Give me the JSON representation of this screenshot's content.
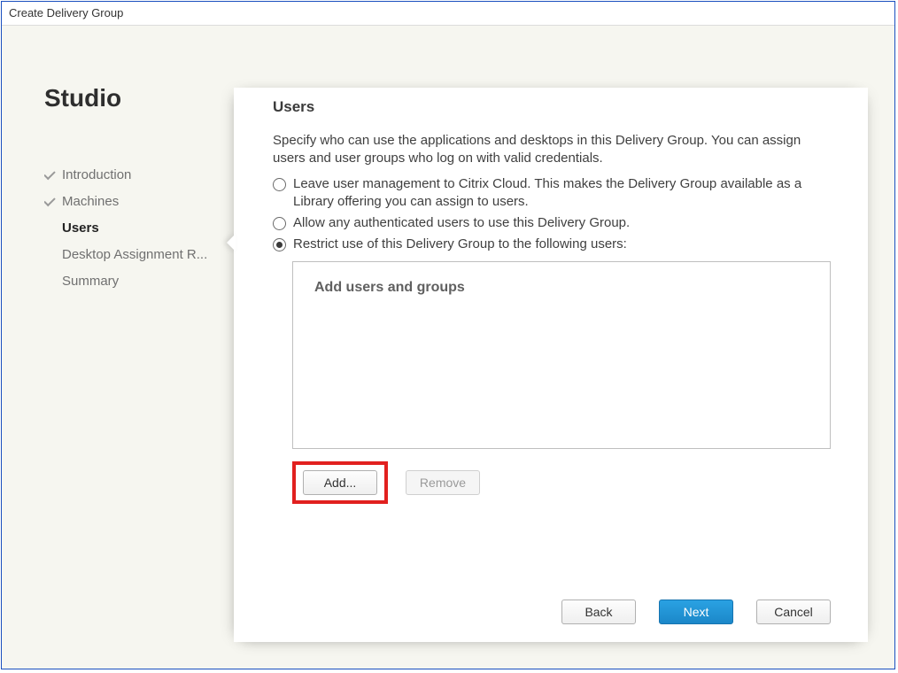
{
  "window": {
    "title": "Create Delivery Group"
  },
  "sidebar": {
    "title": "Studio",
    "items": [
      {
        "label": "Introduction",
        "state": "completed"
      },
      {
        "label": "Machines",
        "state": "completed"
      },
      {
        "label": "Users",
        "state": "current"
      },
      {
        "label": "Desktop Assignment R...",
        "state": "pending"
      },
      {
        "label": "Summary",
        "state": "pending"
      }
    ]
  },
  "page": {
    "title": "Users",
    "description": "Specify who can use the applications and desktops in this Delivery Group. You can assign users and user groups who log on with valid credentials.",
    "options": [
      {
        "label": "Leave user management to Citrix Cloud. This makes the Delivery Group available as a Library offering you can assign to users.",
        "checked": false
      },
      {
        "label": "Allow any authenticated users to use this Delivery Group.",
        "checked": false
      },
      {
        "label": "Restrict use of this Delivery Group to the following users:",
        "checked": true
      }
    ],
    "listbox_placeholder": "Add users and groups",
    "add_label": "Add...",
    "remove_label": "Remove"
  },
  "footer": {
    "back": "Back",
    "next": "Next",
    "cancel": "Cancel"
  }
}
